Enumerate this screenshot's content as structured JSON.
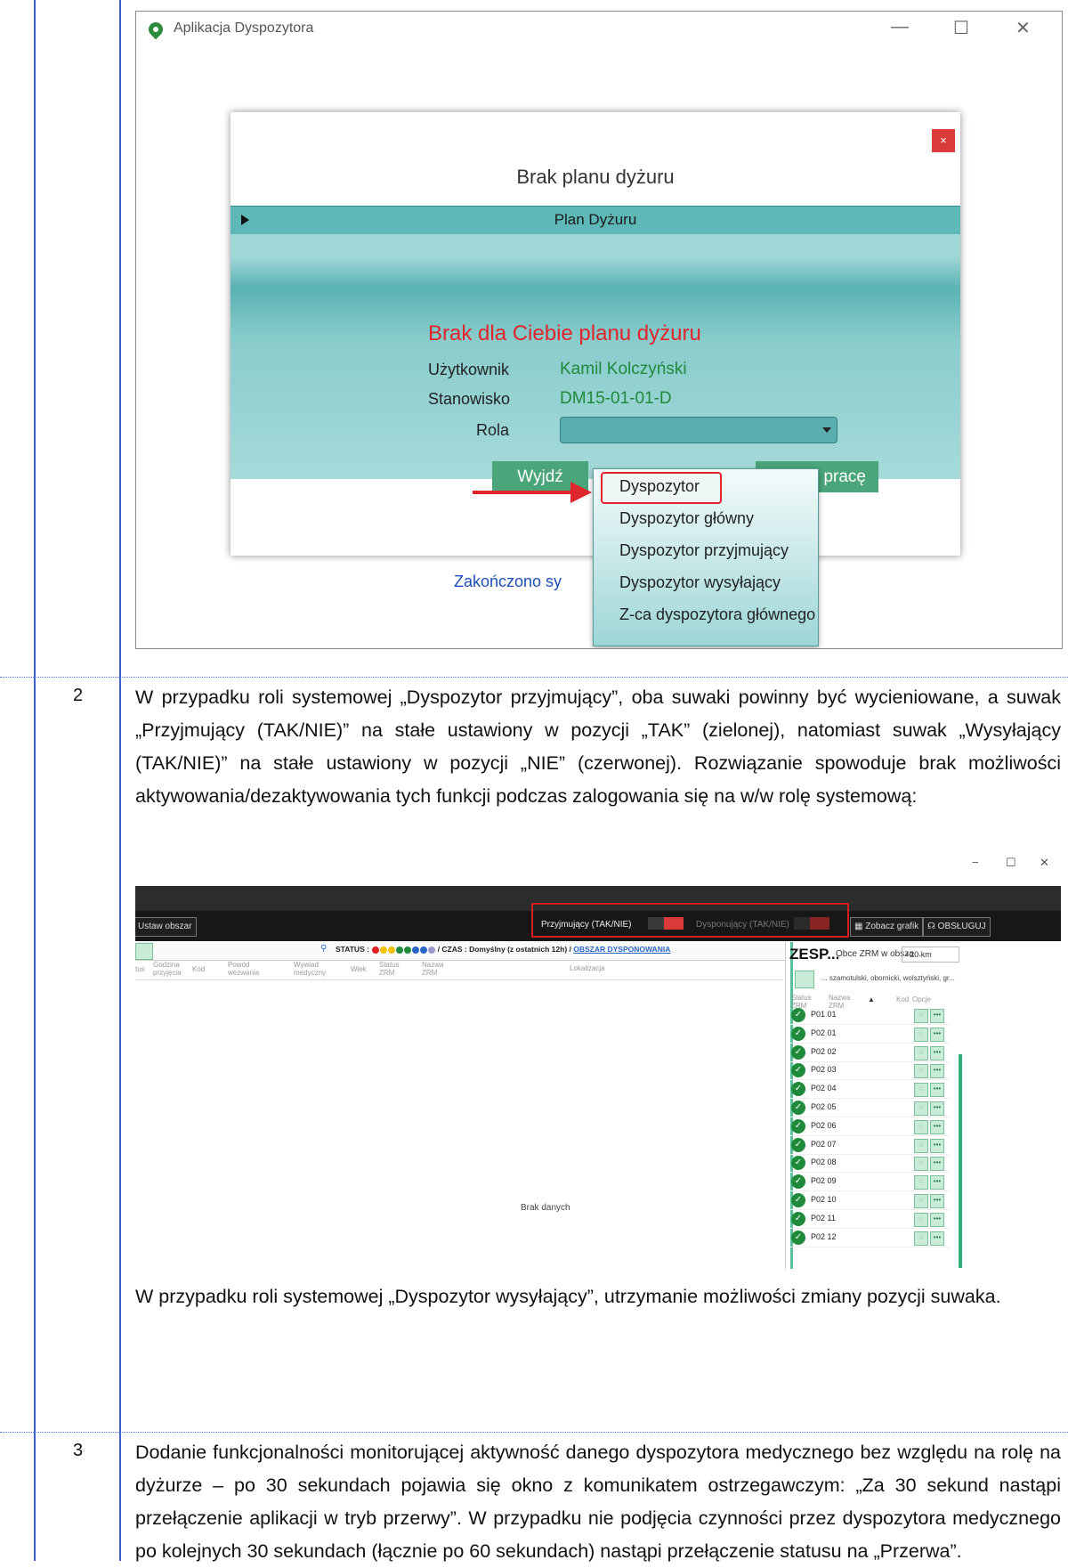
{
  "rows": [
    {
      "num": "2"
    },
    {
      "num": "3"
    }
  ],
  "screenshot1": {
    "window_title": "Aplikacja Dyspozytora",
    "window_controls": {
      "minimize": "—",
      "maximize": "☐",
      "close": "✕"
    },
    "dialog": {
      "close": "×",
      "title": "Brak planu dyżuru",
      "plan_bar": "Plan Dyżuru",
      "error": "Brak dla Ciebie planu dyżuru",
      "user_label": "Użytkownik",
      "user_value": "Kamil Kolczyński",
      "station_label": "Stanowisko",
      "station_value": "DM15-01-01-D",
      "role_label": "Rola",
      "exit_button": "Wyjdź",
      "start_button": "cznij pracę"
    },
    "dropdown_options": [
      "Dyspozytor",
      "Dyspozytor główny",
      "Dyspozytor przyjmujący",
      "Dyspozytor wysyłający",
      "Z-ca dyspozytora głównego"
    ],
    "status_text": "Zakończono sy"
  },
  "row2": {
    "para1": "W przypadku roli systemowej „Dyspozytor przyjmujący”, oba suwaki powinny być wycieniowane, a suwak „Przyjmujący (TAK/NIE)” na stałe ustawiony w pozycji „TAK” (zielonej), natomiast suwak „Wysyłający (TAK/NIE)” na stałe ustawiony w pozycji „NIE” (czerwonej). Rozwiązanie spowoduje brak możliwości aktywowania/dezaktywowania tych funkcji podczas zalogowania się na w/w rolę systemową:",
    "para2": "W przypadku roli systemowej „Dyspozytor wysyłający”, utrzymanie możliwości zmiany pozycji suwaka."
  },
  "screenshot2": {
    "window_controls": {
      "minimize": "−",
      "maximize": "☐",
      "close": "✕"
    },
    "ustaw_obszar": "Ustaw obszar",
    "przyjmujacy_label": "Przyjmujący (TAK/NIE)",
    "dysponujacy_label": "Dysponujący (TAK/NIE)",
    "zobacz_grafik": "Zobacz grafik",
    "obsluguj": "OBSŁUGUJ",
    "status_label": "STATUS :",
    "czas_text": "/ CZAS : Domyślny (z ostatnich 12h) /",
    "obszar_link": "OBSZAR DYSPONOWANIA",
    "status_dot_colors": [
      "#e02020",
      "#f2c200",
      "#f2c200",
      "#1e8a3a",
      "#1e8a3a",
      "#2a66c7",
      "#2a66c7",
      "#9a9ad0"
    ],
    "columns": {
      "status": "tus",
      "godzina": "Godzina przyjęcia",
      "kod": "Kod",
      "powod": "Powód wezwania",
      "wywiad": "Wywiad medyczny",
      "wiek": "Wiek",
      "status_zrm": "Status ZRM",
      "nazwa_zrm": "Nazwa ZRM",
      "lokalizacja": "Lokalizacja"
    },
    "empty_text": "Brak danych",
    "right_panel": {
      "title": "ZESP...",
      "obce": "Obce ZRM w obsza...",
      "km": "+20 km",
      "areas": "... szamotulski, obornicki, wolsztyński, gr...",
      "hdr_status": "Status ZRM",
      "hdr_nazwa": "Nazwa ZRM",
      "hdr_kod": "Kod",
      "hdr_opcje": "Opcje",
      "check_glyph": "✓",
      "units": [
        "P01 01",
        "P02 01",
        "P02 02",
        "P02 03",
        "P02 04",
        "P02 05",
        "P02 06",
        "P02 07",
        "P02 08",
        "P02 09",
        "P02 10",
        "P02 11",
        "P02 12"
      ]
    }
  },
  "row3": {
    "para": "Dodanie funkcjonalności monitorującej aktywność danego dyspozytora medycznego bez względu na rolę na dyżurze – po 30 sekundach pojawia się okno z komunikatem ostrzegawczym: „Za 30 sekund nastąpi przełączenie aplikacji w tryb przerwy”. W przypadku nie podjęcia czynności przez dyspozytora medycznego po kolejnych 30 sekundach (łącznie po 60 sekundach) nastąpi przełączenie statusu na „Przerwa”."
  }
}
